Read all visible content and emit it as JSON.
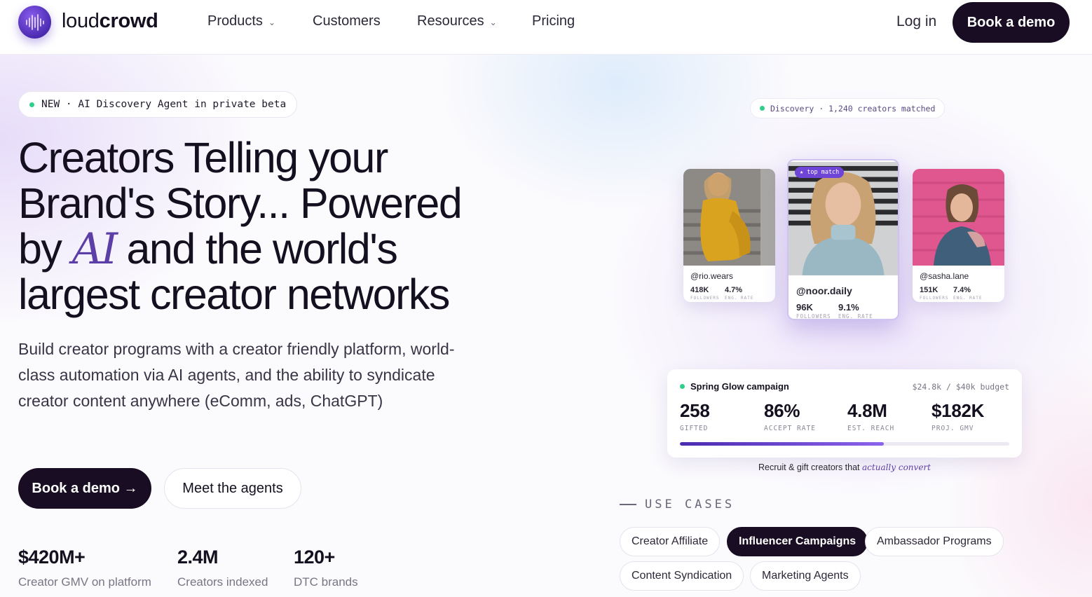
{
  "nav": {
    "logo_text_light": "loud",
    "logo_text_bold": "crowd",
    "items": [
      {
        "label": "Products",
        "has_dropdown": true
      },
      {
        "label": "Customers",
        "has_dropdown": false
      },
      {
        "label": "Resources",
        "has_dropdown": true
      },
      {
        "label": "Pricing",
        "has_dropdown": false
      }
    ],
    "login_label": "Log in",
    "cta_label": "Book a demo"
  },
  "hero": {
    "badge": "NEW · AI Discovery Agent in private beta",
    "headline_line1": "Creators Telling your",
    "headline_line2": "Brand's Story... Powered",
    "headline_by": "by",
    "headline_ai": "AI",
    "headline_line3_rest": "and the world's",
    "headline_line4": "largest creator networks",
    "subcopy": "Build creator programs with a creator friendly platform, world-class automation via AI agents, and the ability to syndicate creator content anywhere (eComm, ads, ChatGPT)",
    "primary_cta": "Book a demo →",
    "secondary_cta": "Meet the agents",
    "stats": [
      {
        "value": "$420M+",
        "label": "Creator GMV on platform"
      },
      {
        "value": "2.4M",
        "label": "Creators indexed"
      },
      {
        "value": "120+",
        "label": "DTC brands"
      }
    ]
  },
  "visual": {
    "discovery_pill": "Discovery · 1,240 creators matched",
    "top_match_label": "★ top match",
    "creators": [
      {
        "handle": "@rio.wears",
        "followers": "418K",
        "eng_rate": "4.7%",
        "followers_caption": "FOLLOWERS",
        "eng_caption": "ENG. RATE"
      },
      {
        "handle": "@noor.daily",
        "followers": "96K",
        "eng_rate": "9.1%",
        "followers_caption": "FOLLOWERS",
        "eng_caption": "ENG. RATE"
      },
      {
        "handle": "@sasha.lane",
        "followers": "151K",
        "eng_rate": "7.4%",
        "followers_caption": "FOLLOWERS",
        "eng_caption": "ENG. RATE"
      }
    ],
    "campaign": {
      "title": "Spring Glow campaign",
      "budget": "$24.8k / $40k budget",
      "progress": 0.62,
      "kpis": [
        {
          "value": "258",
          "label": "GIFTED"
        },
        {
          "value": "86%",
          "label": "ACCEPT RATE"
        },
        {
          "value": "4.8M",
          "label": "EST. REACH"
        },
        {
          "value": "$182K",
          "label": "PROJ. GMV"
        }
      ]
    },
    "tagline_prefix": "Recruit & gift creators that",
    "tagline_em": "actually convert"
  },
  "use_cases": {
    "heading": "USE CASES",
    "chips": [
      {
        "label": "Creator Affiliate",
        "active": false
      },
      {
        "label": "Influencer Campaigns",
        "active": true
      },
      {
        "label": "Ambassador Programs",
        "active": false
      },
      {
        "label": "Content Syndication",
        "active": false
      },
      {
        "label": "Marketing Agents",
        "active": false
      }
    ]
  },
  "colors": {
    "brand_dark": "#180d22",
    "accent_purple": "#5b3ea6",
    "status_green": "#2fcf8a"
  }
}
